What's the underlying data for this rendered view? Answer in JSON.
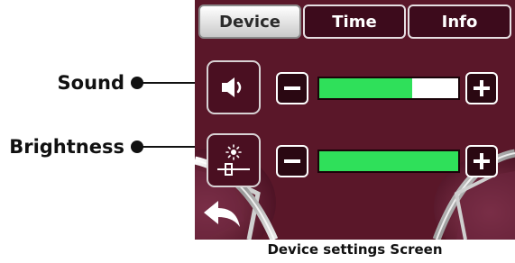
{
  "annotations": {
    "sound_label": "Sound",
    "brightness_label": "Brightness"
  },
  "tabs": [
    {
      "label": "Device",
      "active": true
    },
    {
      "label": "Time",
      "active": false
    },
    {
      "label": "Info",
      "active": false
    }
  ],
  "controls": {
    "sound": {
      "icon": "speaker-icon",
      "level_fraction": 0.67
    },
    "brightness": {
      "icon": "brightness-slider-icon",
      "level_fraction": 1.0
    }
  },
  "back_icon": "back-arrow-icon",
  "caption": "Device settings Screen",
  "colors": {
    "screen_background": "#5a1729",
    "level_fill": "#2fe05a",
    "tab_active": "#e6e6e6",
    "tab_inactive": "#3d0b1c"
  }
}
